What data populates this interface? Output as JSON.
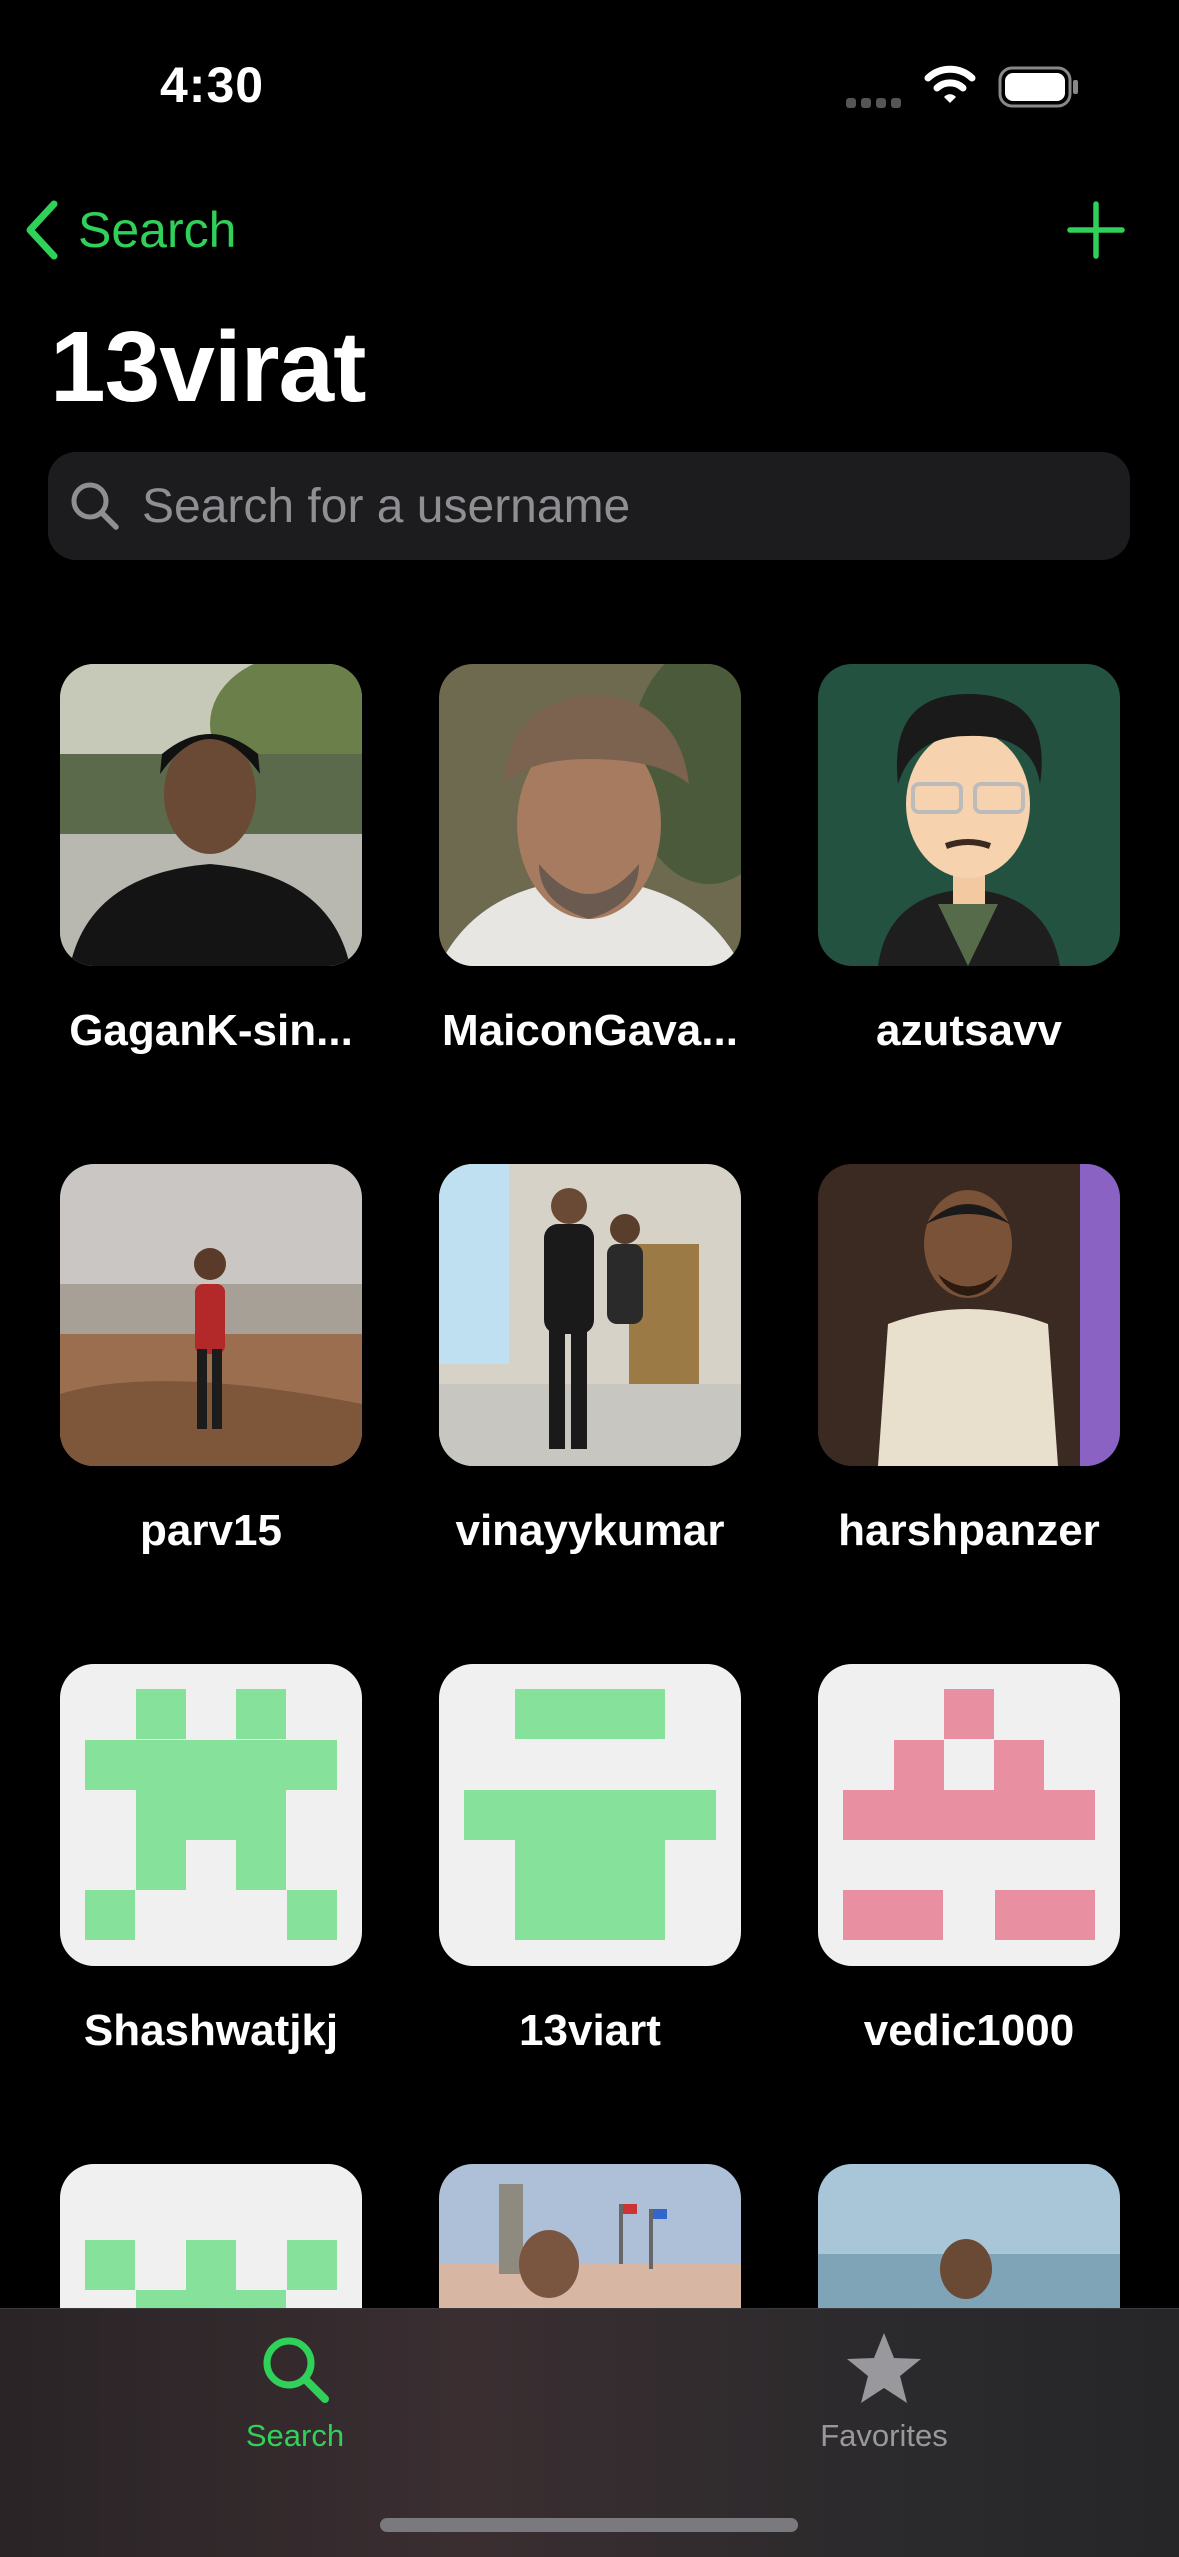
{
  "status_bar": {
    "time": "4:30"
  },
  "nav": {
    "back_label": "Search"
  },
  "title": "13virat",
  "search": {
    "placeholder": "Search for a username",
    "value": ""
  },
  "users": [
    {
      "username": "GaganK-sin..."
    },
    {
      "username": "MaiconGava..."
    },
    {
      "username": "azutsavv"
    },
    {
      "username": "parv15"
    },
    {
      "username": "vinayykumar"
    },
    {
      "username": "harshpanzer"
    },
    {
      "username": "Shashwatjkj"
    },
    {
      "username": "13viart"
    },
    {
      "username": "vedic1000"
    },
    {
      "username": ""
    },
    {
      "username": ""
    },
    {
      "username": ""
    }
  ],
  "tabs": [
    {
      "label": "Search",
      "icon": "search-icon",
      "active": true
    },
    {
      "label": "Favorites",
      "icon": "star-icon",
      "active": false
    }
  ],
  "colors": {
    "accent": "#30d158",
    "background": "#000000",
    "search_field": "#1c1c1e",
    "identicon_green": "#86e29b",
    "identicon_pink": "#e88fa2",
    "identicon_bg": "#f0f0f0"
  }
}
